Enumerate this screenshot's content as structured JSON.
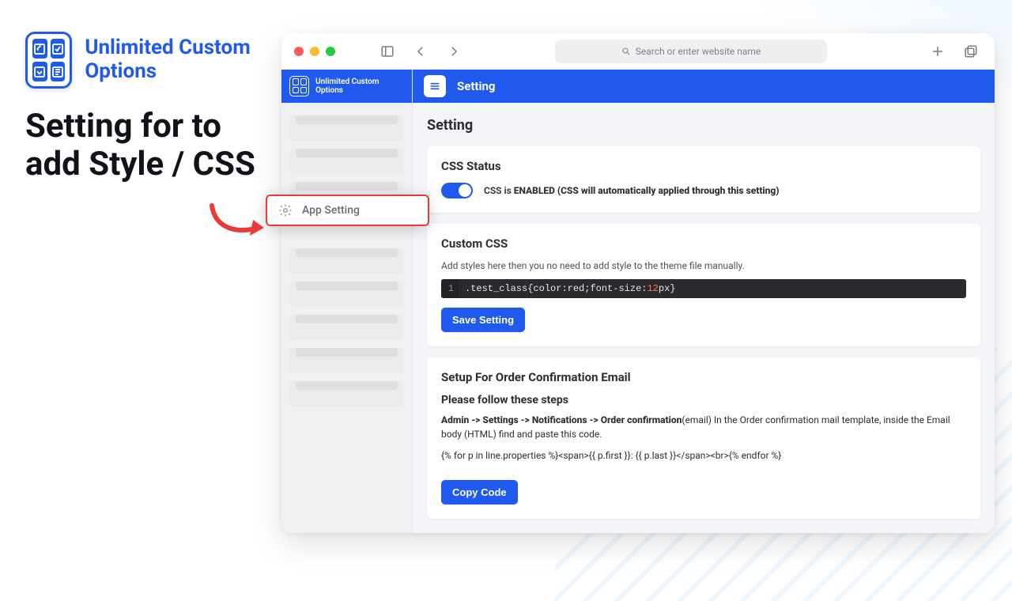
{
  "promo": {
    "brand": "Unlimited Custom Options",
    "heading": "Setting for to add Style / CSS"
  },
  "browser": {
    "url_placeholder": "Search or enter website name"
  },
  "sidebar": {
    "brand": "Unlimited Custom Options",
    "highlighted_item": "App Setting"
  },
  "topbar": {
    "title": "Setting"
  },
  "page": {
    "heading": "Setting"
  },
  "css_status_card": {
    "title": "CSS Status",
    "enabled": true,
    "status_prefix": "CSS is ",
    "status_bold": "ENABLED (CSS will automatically applied through this setting)"
  },
  "custom_css_card": {
    "title": "Custom CSS",
    "desc": "Add styles here then you no need to add style to the theme file manually.",
    "line_no": "1",
    "code_selector": ".test_class",
    "code_lbrace": "{",
    "code_prop1": "color",
    "code_val1": "red",
    "code_prop2": "font-size",
    "code_num": "12",
    "code_unit_rbrace": "px}",
    "colon": ":",
    "semicolon": ";",
    "save_button": "Save Setting"
  },
  "email_card": {
    "title": "Setup For Order Confirmation Email",
    "steps_heading": "Please follow these steps",
    "path_bold": "Admin -> Settings -> Notifications -> Order confirmation",
    "path_rest": "(email) In the Order confirmation mail template, inside the Email body (HTML) find and paste this code.",
    "liquid_code": "{% for p in line.properties %}<span>{{ p.first }}: {{ p.last }}</span><br>{% endfor %}",
    "copy_button": "Copy Code"
  }
}
